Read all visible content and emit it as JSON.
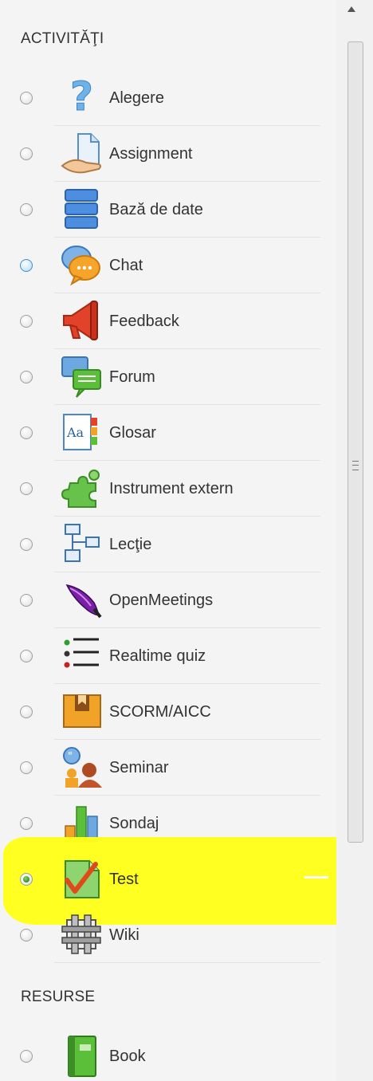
{
  "sections": {
    "activities": "ACTIVITĂŢI",
    "resources": "RESURSE"
  },
  "activities": [
    {
      "label": "Alegere",
      "icon": "question-icon"
    },
    {
      "label": "Assignment",
      "icon": "assignment-icon"
    },
    {
      "label": "Bază de date",
      "icon": "database-icon"
    },
    {
      "label": "Chat",
      "icon": "chat-icon"
    },
    {
      "label": "Feedback",
      "icon": "megaphone-icon"
    },
    {
      "label": "Forum",
      "icon": "forum-icon"
    },
    {
      "label": "Glosar",
      "icon": "glossary-icon"
    },
    {
      "label": "Instrument extern",
      "icon": "puzzle-icon"
    },
    {
      "label": "Lecţie",
      "icon": "lesson-icon"
    },
    {
      "label": "OpenMeetings",
      "icon": "feather-icon"
    },
    {
      "label": "Realtime quiz",
      "icon": "list-icon"
    },
    {
      "label": "SCORM/AICC",
      "icon": "scorm-box-icon"
    },
    {
      "label": "Seminar",
      "icon": "workshop-icon"
    },
    {
      "label": "Sondaj",
      "icon": "survey-icon"
    },
    {
      "label": "Test",
      "icon": "quiz-check-icon"
    },
    {
      "label": "Wiki",
      "icon": "wiki-icon"
    }
  ],
  "resources": [
    {
      "label": "Book",
      "icon": "book-icon"
    }
  ],
  "state": {
    "selected": "Test",
    "hovered": "Chat"
  },
  "colors": {
    "highlight": "#ffff1a",
    "selected_radio": "#1f6d12",
    "hover_radio": "#3f8fd0"
  }
}
